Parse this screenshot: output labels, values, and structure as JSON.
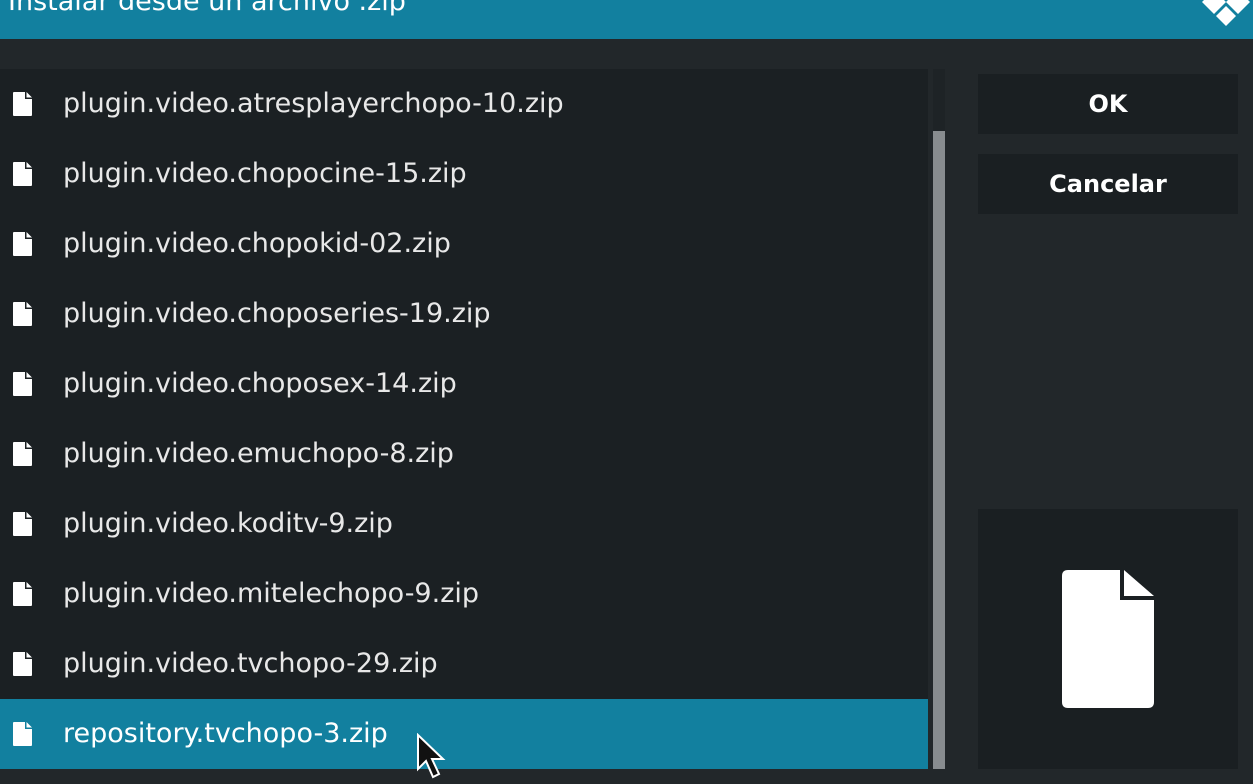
{
  "header": {
    "title": "Instalar desde un archivo .zip",
    "logo": "kodi-logo"
  },
  "files": {
    "icon": "file-icon",
    "items": [
      {
        "label": "plugin.video.atresplayerchopo-10.zip",
        "selected": false
      },
      {
        "label": "plugin.video.chopocine-15.zip",
        "selected": false
      },
      {
        "label": "plugin.video.chopokid-02.zip",
        "selected": false
      },
      {
        "label": "plugin.video.choposeries-19.zip",
        "selected": false
      },
      {
        "label": "plugin.video.choposex-14.zip",
        "selected": false
      },
      {
        "label": "plugin.video.emuchopo-8.zip",
        "selected": false
      },
      {
        "label": "plugin.video.koditv-9.zip",
        "selected": false
      },
      {
        "label": "plugin.video.mitelechopo-9.zip",
        "selected": false
      },
      {
        "label": "plugin.video.tvchopo-29.zip",
        "selected": false
      },
      {
        "label": "repository.tvchopo-3.zip",
        "selected": true
      }
    ]
  },
  "buttons": {
    "ok_label": "OK",
    "cancel_label": "Cancelar"
  },
  "preview": {
    "icon": "file-icon"
  },
  "colors": {
    "accent": "#12809f",
    "background": "#22272a",
    "list_background": "#1b2023",
    "button_background": "#1a1f22"
  }
}
